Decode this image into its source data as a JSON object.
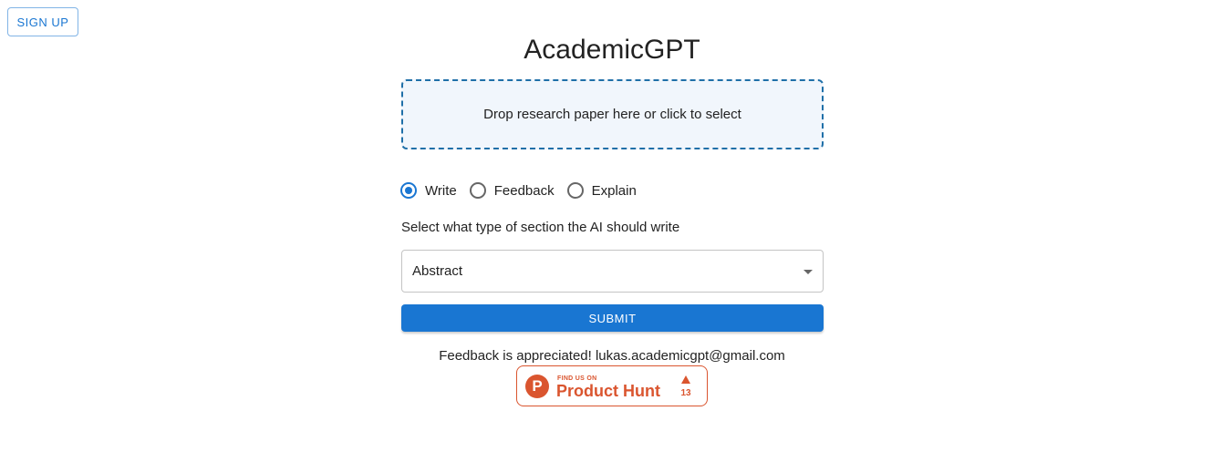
{
  "header": {
    "signup_label": "SIGN UP"
  },
  "main": {
    "title": "AcademicGPT",
    "dropzone_text": "Drop research paper here or click to select",
    "modes": [
      {
        "label": "Write",
        "checked": true
      },
      {
        "label": "Feedback",
        "checked": false
      },
      {
        "label": "Explain",
        "checked": false
      }
    ],
    "section_prompt": "Select what type of section the AI should write",
    "section_select": {
      "value": "Abstract"
    },
    "submit_label": "SUBMIT",
    "feedback_text": "Feedback is appreciated! lukas.academicgpt@gmail.com"
  },
  "product_hunt": {
    "logo_letter": "P",
    "tagline": "FIND US ON",
    "name": "Product Hunt",
    "votes": "13"
  },
  "colors": {
    "primary": "#1976d2",
    "dropzone_border": "#1f6fa8",
    "dropzone_bg": "#f1f6fc",
    "product_hunt": "#da552f"
  }
}
